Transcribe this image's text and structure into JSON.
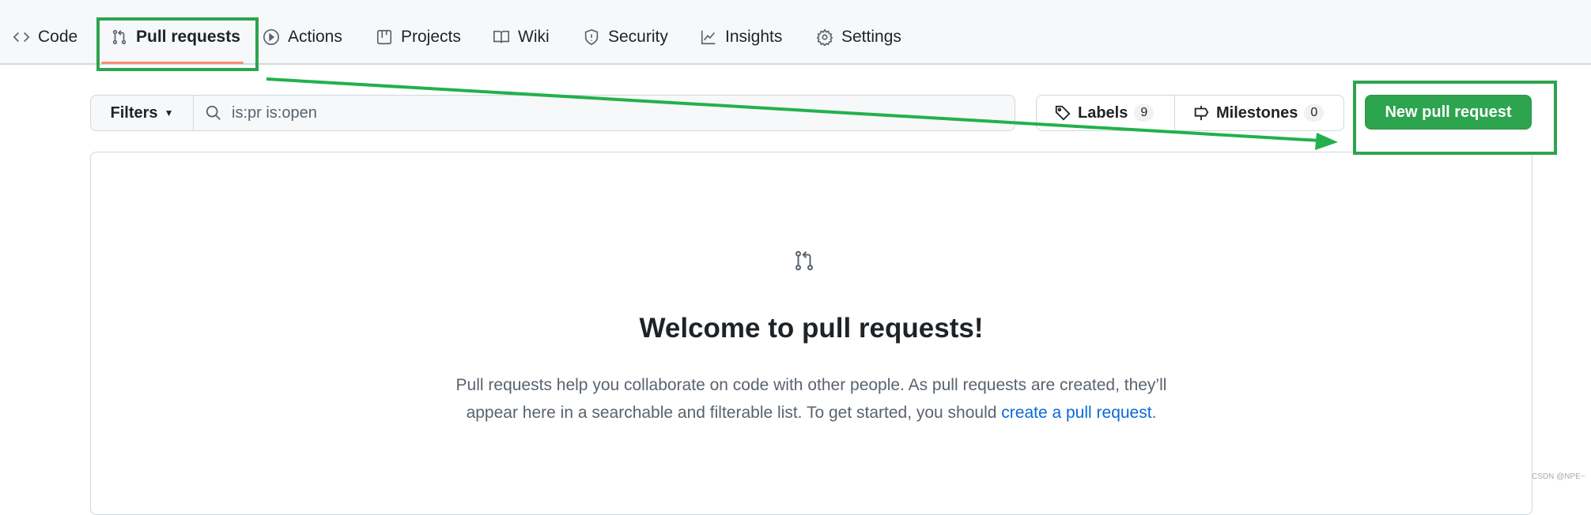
{
  "nav": {
    "tabs": [
      {
        "label": "Code",
        "icon": "code-icon"
      },
      {
        "label": "Pull requests",
        "icon": "git-pull-request-icon",
        "active": true
      },
      {
        "label": "Actions",
        "icon": "play-icon"
      },
      {
        "label": "Projects",
        "icon": "table-icon"
      },
      {
        "label": "Wiki",
        "icon": "book-icon"
      },
      {
        "label": "Security",
        "icon": "shield-icon"
      },
      {
        "label": "Insights",
        "icon": "graph-icon"
      },
      {
        "label": "Settings",
        "icon": "gear-icon"
      }
    ]
  },
  "filters": {
    "label": "Filters",
    "query": "is:pr is:open"
  },
  "labels": {
    "label": "Labels",
    "count": "9"
  },
  "milestones": {
    "label": "Milestones",
    "count": "0"
  },
  "new_pr": {
    "label": "New pull request"
  },
  "blank": {
    "title": "Welcome to pull requests!",
    "text1": "Pull requests help you collaborate on code with other people. As pull requests are created, they’ll",
    "text2": "appear here in a searchable and filterable list. To get started, you should ",
    "link": "create a pull request",
    "end": "."
  },
  "watermark": "CSDN @NPE~",
  "colors": {
    "accent": "#2da44e",
    "annotation": "#22b14c",
    "underline": "#fd8c73",
    "link": "#0969da"
  }
}
